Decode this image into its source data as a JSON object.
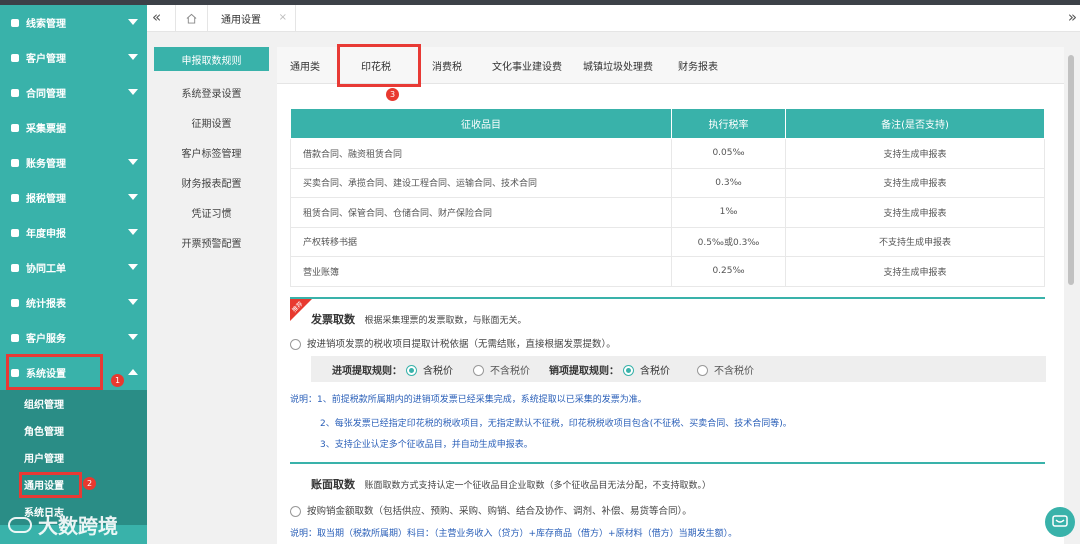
{
  "sidebar": {
    "items": [
      {
        "label": "线索管理",
        "icon": "clue-icon",
        "arrow": "down"
      },
      {
        "label": "客户管理",
        "icon": "customer-icon",
        "arrow": "down"
      },
      {
        "label": "合同管理",
        "icon": "contract-icon",
        "arrow": "down"
      },
      {
        "label": "采集票据",
        "icon": "ticket-icon",
        "arrow": ""
      },
      {
        "label": "账务管理",
        "icon": "accounting-icon",
        "arrow": "down"
      },
      {
        "label": "报税管理",
        "icon": "tax-icon",
        "arrow": "down"
      },
      {
        "label": "年度申报",
        "icon": "annual-icon",
        "arrow": "down"
      },
      {
        "label": "协同工单",
        "icon": "workorder-icon",
        "arrow": "down"
      },
      {
        "label": "统计报表",
        "icon": "stats-icon",
        "arrow": "down"
      },
      {
        "label": "客户服务",
        "icon": "service-icon",
        "arrow": "down"
      },
      {
        "label": "系统设置",
        "icon": "settings-icon",
        "arrow": "up"
      }
    ],
    "subitems": [
      "组织管理",
      "角色管理",
      "用户管理",
      "通用设置",
      "系统日志"
    ]
  },
  "badges": {
    "b1": "1",
    "b2": "2",
    "b3": "3"
  },
  "tabbar": {
    "current": "通用设置",
    "close": "×"
  },
  "leftnav": [
    "申报取数规则",
    "系统登录设置",
    "征期设置",
    "客户标签管理",
    "财务报表配置",
    "凭证习惯",
    "开票预警配置"
  ],
  "ctabs": [
    "通用类",
    "印花税",
    "消费税",
    "文化事业建设费",
    "城镇垃圾处理费",
    "财务报表"
  ],
  "table": {
    "headers": [
      "征收品目",
      "执行税率",
      "备注(是否支持)"
    ],
    "rows": [
      [
        "借款合同、融资租赁合同",
        "0.05‰",
        "支持生成申报表"
      ],
      [
        "买卖合同、承揽合同、建设工程合同、运输合同、技术合同",
        "0.3‰",
        "支持生成申报表"
      ],
      [
        "租赁合同、保管合同、仓储合同、财产保险合同",
        "1‰",
        "支持生成申报表"
      ],
      [
        "产权转移书据",
        "0.5‰或0.3‰",
        "不支持生成申报表"
      ],
      [
        "营业账簿",
        "0.25‰",
        "支持生成申报表"
      ]
    ]
  },
  "invoice": {
    "ribbon": "推荐",
    "title": "发票取数",
    "desc": "根据采集理票的发票取数，与账面无关。",
    "option": "按进销项发票的税收项目提取计税依据（无需结账，直接根据发票提数）。",
    "in_label": "进项提取规则：",
    "out_label": "销项提取规则：",
    "tax_incl": "含税价",
    "tax_excl": "不含税价",
    "note1": "说明：1、前提税款所属期内的进销项发票已经采集完成，系统提取以已采集的发票为准。",
    "note2": "2、每张发票已经指定印花税的税收项目，无指定默认不征税，印花税税收项目包含(不征税、买卖合同、技术合同等)。",
    "note3": "3、支持企业认定多个征收品目，并自动生成申报表。"
  },
  "ledger": {
    "title": "账面取数",
    "desc": "账面取数方式支持认定一个征收品目企业取数（多个征收品目无法分配，不支持取数。）",
    "option": "按购销金额取数（包括供应、预购、采购、购销、结合及协作、调剂、补偿、易货等合同）。",
    "note": "说明：取当期（税款所属期）科目：（主营业务收入（贷方）+库存商品（借方）+原材料（借方）当期发生额）。"
  },
  "watermark": "大数跨境",
  "colors": {
    "accent": "#39b2aa",
    "highlight": "#e83a35"
  }
}
